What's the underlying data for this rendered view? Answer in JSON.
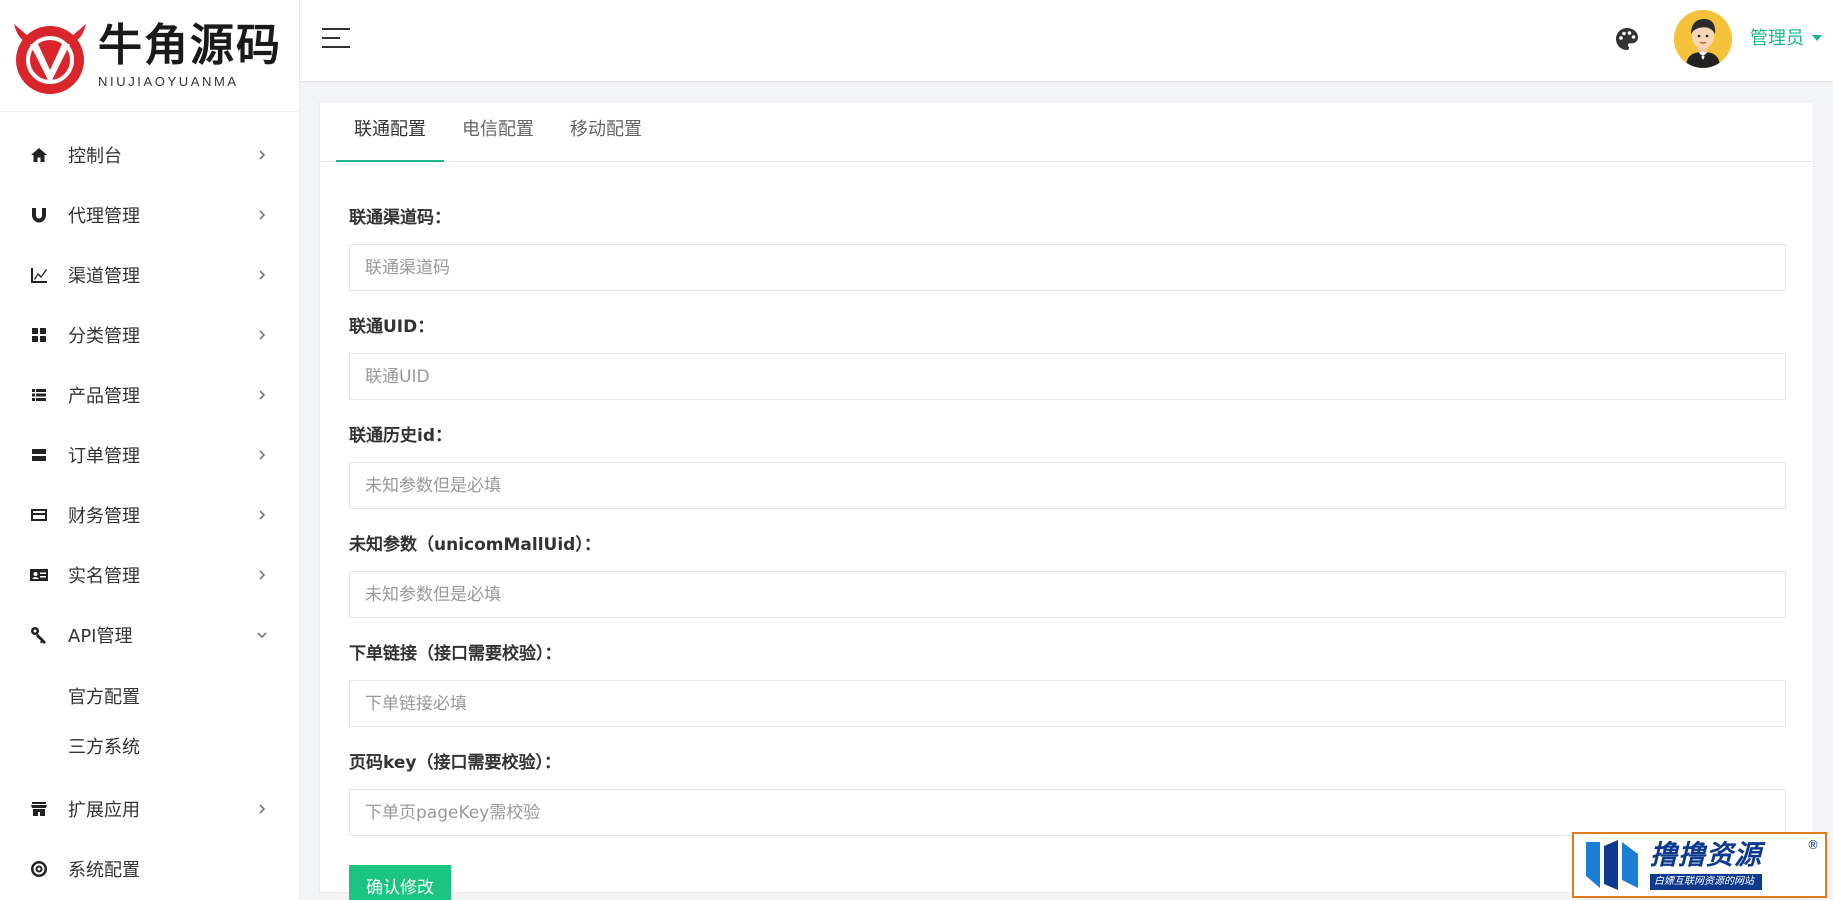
{
  "brand": {
    "name_cn": "牛角源码",
    "name_en": "NIUJIAOYUANMA",
    "accent_color": "#1fb58a",
    "logo_color": "#d8262c"
  },
  "sidebar": {
    "items": [
      {
        "label": "控制台",
        "icon": "home-icon"
      },
      {
        "label": "代理管理",
        "icon": "magnet-icon"
      },
      {
        "label": "渠道管理",
        "icon": "chart-icon"
      },
      {
        "label": "分类管理",
        "icon": "grid-icon"
      },
      {
        "label": "产品管理",
        "icon": "list-icon"
      },
      {
        "label": "订单管理",
        "icon": "order-icon"
      },
      {
        "label": "财务管理",
        "icon": "card-icon"
      },
      {
        "label": "实名管理",
        "icon": "id-card-icon"
      },
      {
        "label": "API管理",
        "icon": "key-icon",
        "expanded": true
      }
    ],
    "subitems": [
      {
        "label": "官方配置"
      },
      {
        "label": "三方系统"
      }
    ],
    "bottom_items": [
      {
        "label": "扩展应用",
        "icon": "store-icon"
      },
      {
        "label": "系统配置",
        "icon": "settings-icon"
      }
    ]
  },
  "header": {
    "user_name": "管理员",
    "palette_icon": "palette-icon",
    "menu_icon": "hamburger-icon"
  },
  "tabs": [
    {
      "label": "联通配置",
      "active": true
    },
    {
      "label": "电信配置",
      "active": false
    },
    {
      "label": "移动配置",
      "active": false
    }
  ],
  "form": {
    "fields": [
      {
        "label": "联通渠道码：",
        "placeholder": "联通渠道码",
        "value": ""
      },
      {
        "label": "联通UID：",
        "placeholder": "联通UID",
        "value": ""
      },
      {
        "label": "联通历史id：",
        "placeholder": "未知参数但是必填",
        "value": ""
      },
      {
        "label": "未知参数（unicomMallUid）：",
        "placeholder": "未知参数但是必填",
        "value": ""
      },
      {
        "label": "下单链接（接口需要校验）：",
        "placeholder": "下单链接必填",
        "value": ""
      },
      {
        "label": "页码key（接口需要校验）：",
        "placeholder": "下单页pageKey需校验",
        "value": ""
      }
    ],
    "submit_label": "确认修改",
    "submit_color": "#1cc481"
  },
  "watermark": {
    "title": "撸撸资源",
    "subtitle": "白嫖互联网资源的网站",
    "reg": "®"
  }
}
